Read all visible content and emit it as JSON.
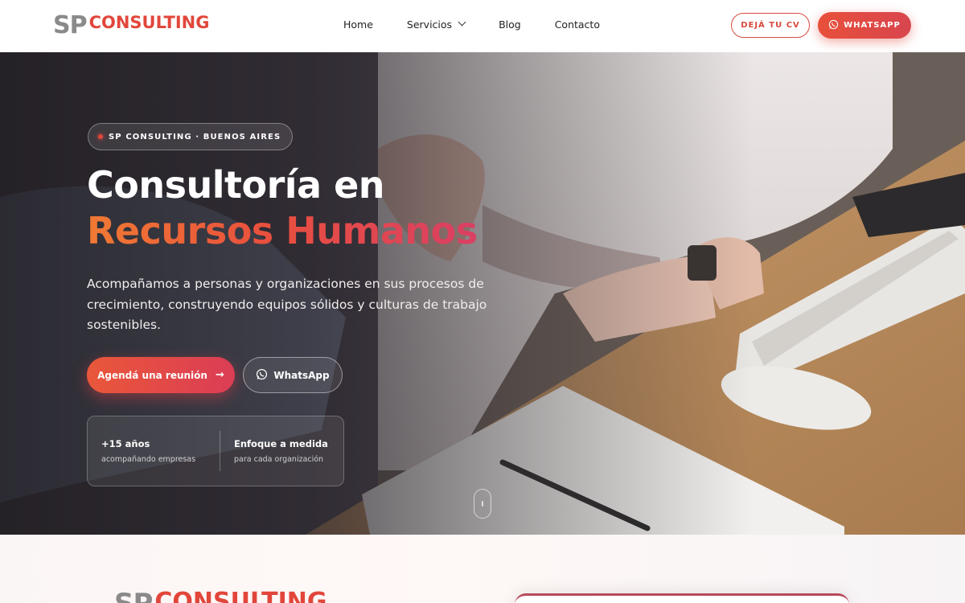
{
  "header": {
    "logo": {
      "sp": "SP",
      "consulting": "CONSULTING"
    },
    "nav": [
      {
        "label": "Home"
      },
      {
        "label": "Servicios",
        "has_dropdown": true
      },
      {
        "label": "Blog"
      },
      {
        "label": "Contacto"
      }
    ],
    "cv_button": "DEJÁ TU CV",
    "whatsapp_button": "WHATSAPP"
  },
  "hero": {
    "badge": "SP CONSULTING · BUENOS AIRES",
    "title_line1": "Consultoría en",
    "title_line2": "Recursos Humanos",
    "lead": "Acompañamos a personas y organizaciones en sus procesos de crecimiento, construyendo equipos sólidos y culturas de trabajo sostenibles.",
    "primary_button": "Agendá una reunión",
    "secondary_button": "WhatsApp",
    "stats": [
      {
        "title": "+15 años",
        "subtitle": "acompañando empresas"
      },
      {
        "title": "Enfoque a medida",
        "subtitle": "para cada organización"
      }
    ]
  },
  "section2": {
    "logo": {
      "sp": "SP",
      "consulting": "CONSULTING"
    }
  },
  "colors": {
    "accent": "#e2463b",
    "accent_gradient_start": "#f07a33",
    "accent_gradient_end": "#d93f63",
    "logo_gray": "#8a8a8a"
  },
  "icons": [
    "chevron-down-icon",
    "whatsapp-icon",
    "arrow-right-icon",
    "scroll-mouse-icon"
  ]
}
